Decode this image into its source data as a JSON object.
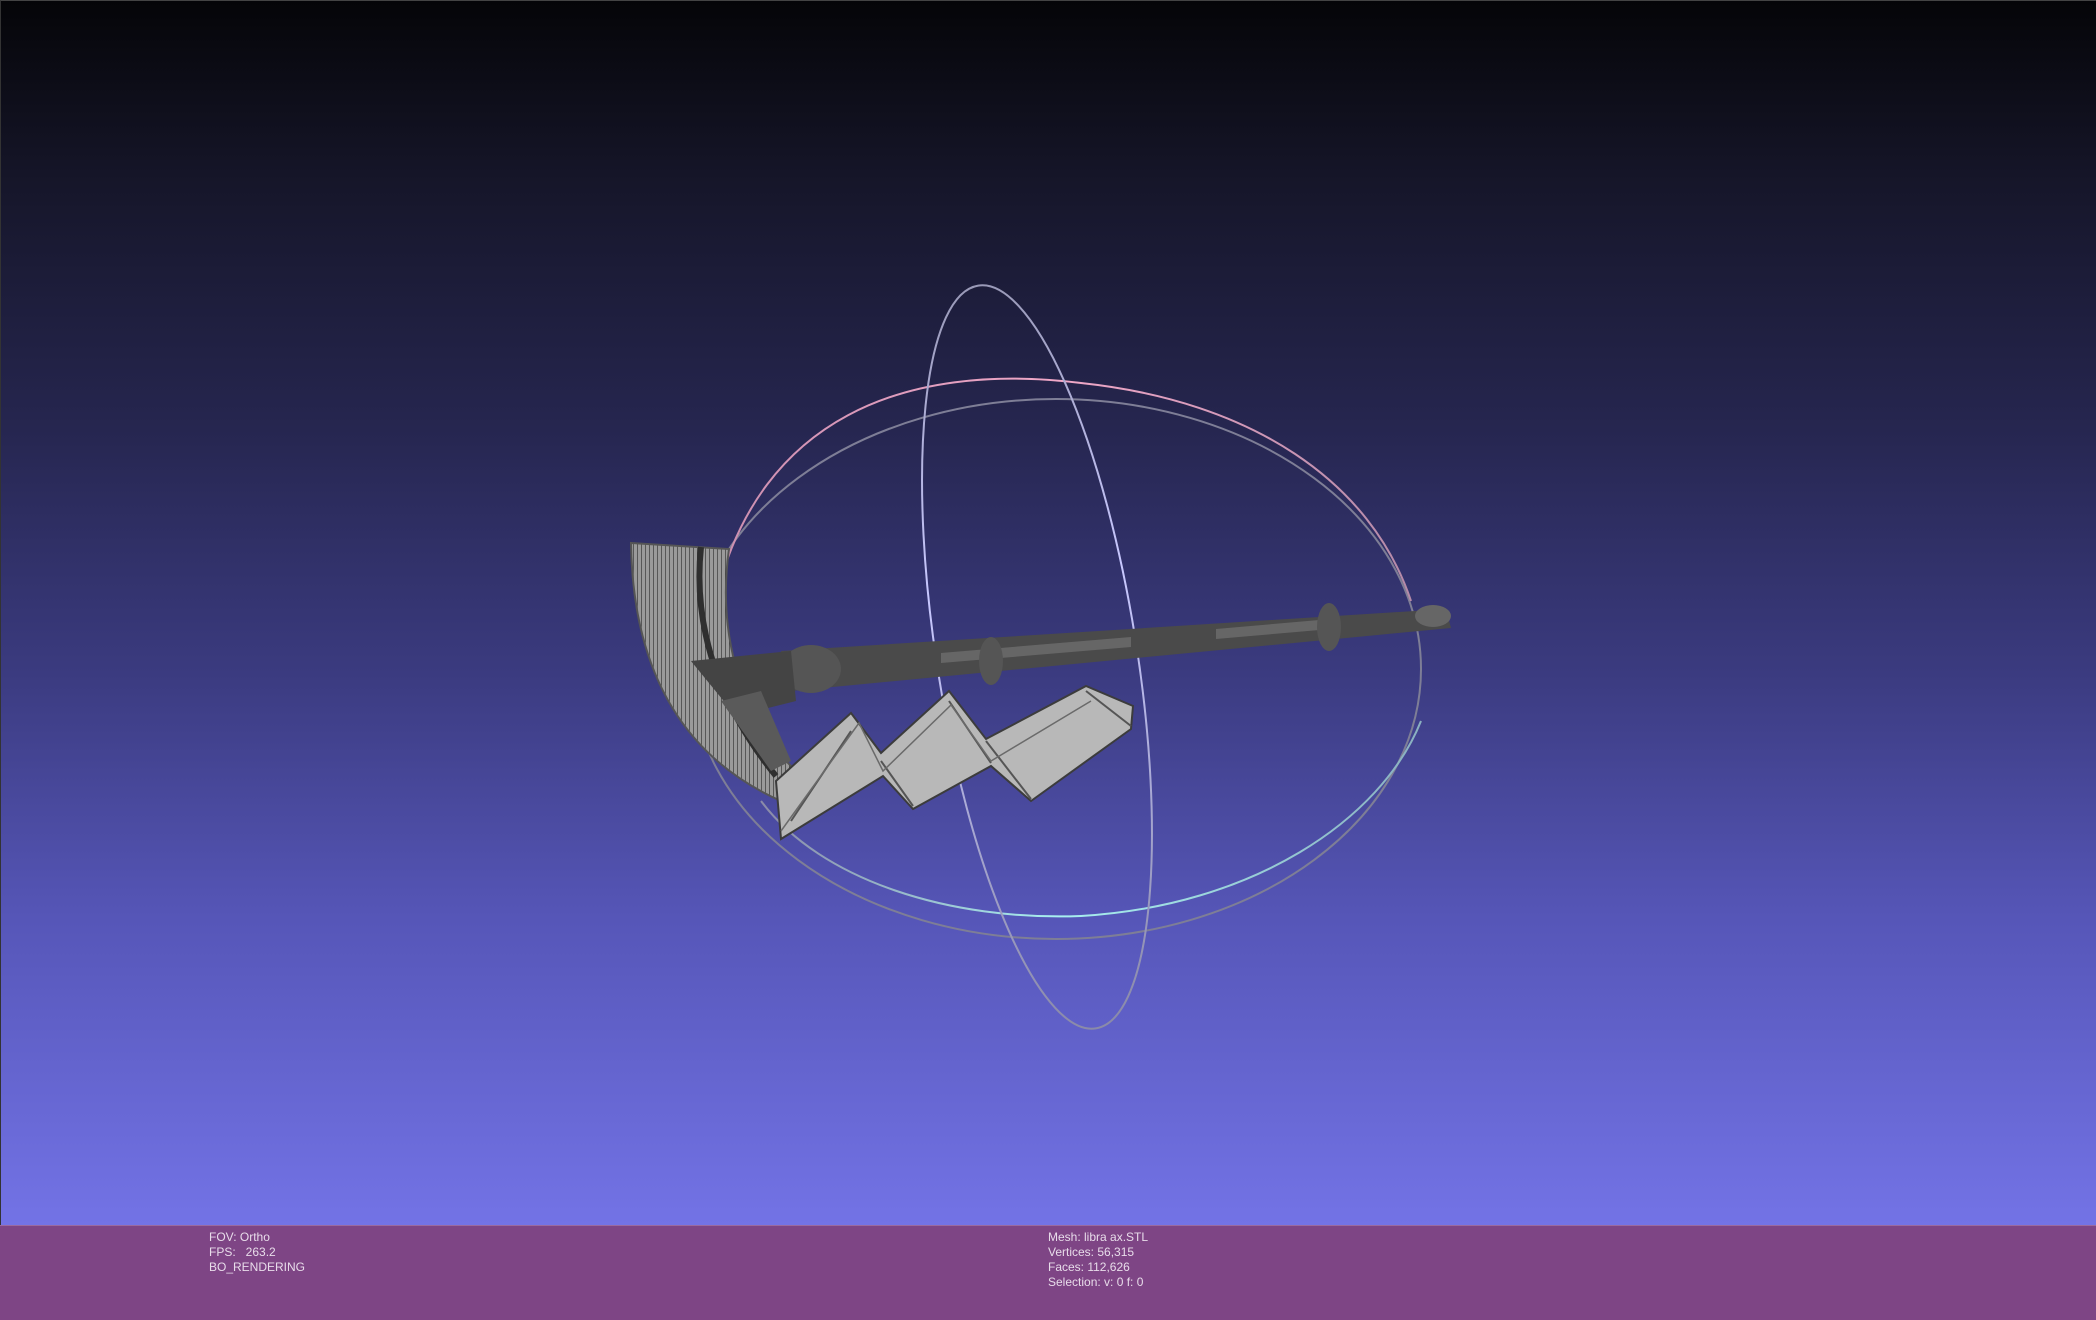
{
  "viewport": {
    "icons": {
      "mesh": "axe-mesh-icon",
      "trackball": "trackball-gizmo-icon"
    },
    "colors": {
      "gradient_top": "#050508",
      "gradient_bottom": "#7373e6",
      "mesh_fill": "#4a4a4a",
      "mesh_light": "#bdbdbd",
      "ring_x": "#b9b9ff",
      "ring_y": "#f0a8c8",
      "ring_z": "#9ee0e0"
    }
  },
  "info_bar": {
    "background": "#7e4585",
    "left": {
      "fov": "FOV: Ortho",
      "fps": "FPS:   263.2",
      "mode": "BO_RENDERING"
    },
    "right": {
      "mesh": "Mesh: libra ax.STL",
      "vertices": "Vertices: 56,315",
      "faces": "Faces: 112,626",
      "selection": "Selection: v: 0 f: 0"
    }
  }
}
